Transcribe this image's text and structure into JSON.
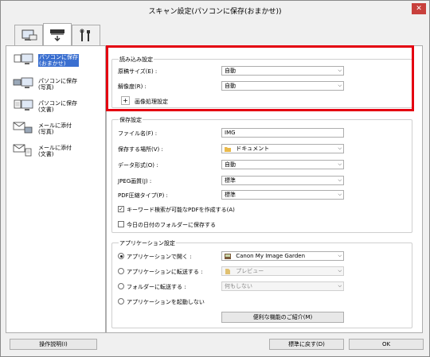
{
  "window": {
    "title": "スキャン設定(パソコンに保存(おまかせ))",
    "close": "✕"
  },
  "tabs": [
    {
      "name": "scan-from-computer",
      "active": false
    },
    {
      "name": "scan-from-operation-panel",
      "active": true
    },
    {
      "name": "general-settings",
      "active": false
    }
  ],
  "left_items": [
    {
      "label": "パソコンに保存\n(おまかせ)",
      "icon": "computer-auto-icon",
      "selected": true
    },
    {
      "label": "パソコンに保存\n(写真)",
      "icon": "computer-photo-icon",
      "selected": false
    },
    {
      "label": "パソコンに保存\n(文書)",
      "icon": "computer-document-icon",
      "selected": false
    },
    {
      "label": "メールに添付\n(写真)",
      "icon": "mail-photo-icon",
      "selected": false
    },
    {
      "label": "メールに添付\n(文書)",
      "icon": "mail-document-icon",
      "selected": false
    }
  ],
  "scan_settings": {
    "title": "読み込み設定",
    "paper_size_label": "原稿サイズ(E) :",
    "paper_size_value": "自動",
    "resolution_label": "解像度(R) :",
    "resolution_value": "自動",
    "image_processing_label": "画像処理設定",
    "plus": "+"
  },
  "save_settings": {
    "title": "保存設定",
    "file_name_label": "ファイル名(F) :",
    "file_name_value": "IMG",
    "save_in_label": "保存する場所(V) :",
    "save_in_value": "ドキュメント",
    "data_format_label": "データ形式(O) :",
    "data_format_value": "自動",
    "jpeg_quality_label": "JPEG画質(J) :",
    "jpeg_quality_value": "標準",
    "pdf_compression_label": "PDF圧縮タイプ(P) :",
    "pdf_compression_value": "標準",
    "keyword_pdf_label": "キーワード検索が可能なPDFを作成する(A)",
    "keyword_pdf_checked": true,
    "date_folder_label": "今日の日付のフォルダーに保存する",
    "date_folder_checked": false
  },
  "app_settings": {
    "title": "アプリケーション設定",
    "open_with_label": "アプリケーションで開く :",
    "open_with_value": "Canon My Image Garden",
    "send_to_app_label": "アプリケーションに転送する :",
    "send_to_app_value": "プレビュー",
    "send_to_folder_label": "フォルダーに転送する :",
    "send_to_folder_value": "何もしない",
    "do_not_start_label": "アプリケーションを起動しない",
    "more_functions_label": "便利な機能のご紹介(M)",
    "selected": "open_with"
  },
  "footer": {
    "instructions_label": "操作説明(I)",
    "defaults_label": "標準に戻す(D)",
    "ok_label": "OK"
  },
  "colors": {
    "highlight_border": "#e40010",
    "selection": "#3a6fd0"
  }
}
